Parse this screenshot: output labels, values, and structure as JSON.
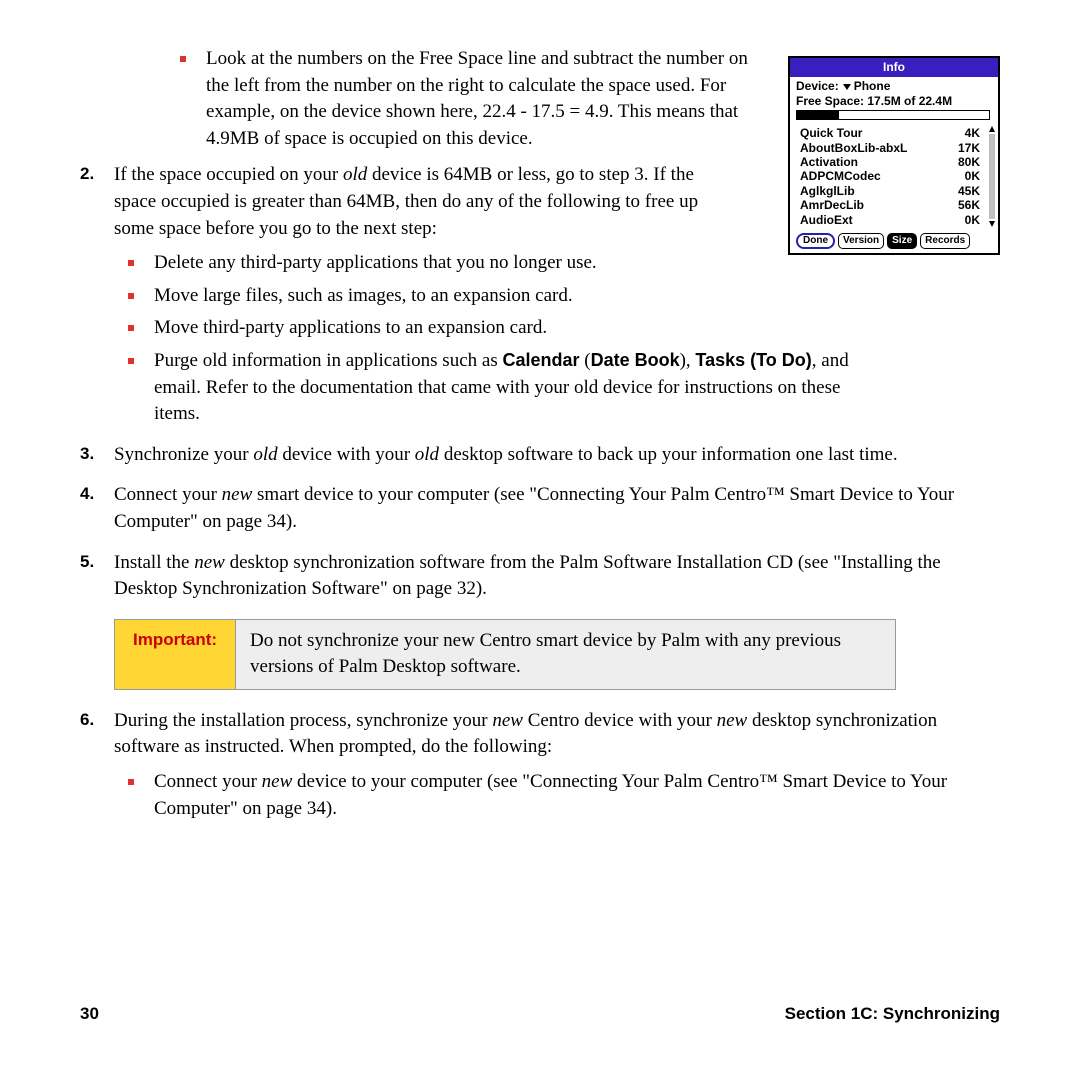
{
  "bullet1": "Look at the numbers on the Free Space line and subtract the number on the left from the number on the right to calculate the space used. For example, on the device shown here, 22.4 - 17.5 = 4.9. This means that 4.9MB of space is occupied on this device.",
  "steps": {
    "s2": {
      "num": "2.",
      "text_a": "If the space occupied on your ",
      "text_b": " device is 64MB or less, go to step 3. If the space occupied is greater than 64MB, then do any of the following to free up some space before you go to the next step:",
      "old": "old",
      "sub": {
        "a": "Delete any third-party applications that you no longer use.",
        "b": "Move large files, such as images, to an expansion card.",
        "c": "Move third-party applications to an expansion card.",
        "d_pre": "Purge old information in applications such as ",
        "d_cal": "Calendar",
        "d_paren1": " (",
        "d_db": "Date Book",
        "d_paren2": "), ",
        "d_tasks": "Tasks (To Do)",
        "d_post": ", and email. Refer to the documentation that came with your old device for instructions on these items."
      }
    },
    "s3": {
      "num": "3.",
      "a": "Synchronize your ",
      "old1": "old",
      "b": " device with your ",
      "old2": "old",
      "c": " desktop software to back up your information one last time."
    },
    "s4": {
      "num": "4.",
      "a": "Connect your ",
      "new1": "new",
      "b": " smart device to your computer (see \"Connecting Your Palm Centro™ Smart Device to Your Computer\" on page 34)."
    },
    "s5": {
      "num": "5.",
      "a": "Install the ",
      "new1": "new",
      "b": " desktop synchronization software from the Palm Software Installation CD (see \"Installing the Desktop Synchronization Software\" on page 32)."
    },
    "s6": {
      "num": "6.",
      "a": "During the installation process, synchronize your ",
      "new1": "new",
      "b": " Centro device with your ",
      "new2": "new",
      "c": " desktop synchronization software as instructed. When prompted, do the following:",
      "sub": {
        "a_pre": "Connect your ",
        "a_new": "new",
        "a_post": " device to your computer (see \"Connecting Your Palm Centro™ Smart Device to Your Computer\" on page 34)."
      }
    }
  },
  "important": {
    "label": "Important:",
    "text": "Do not synchronize your new Centro smart device by Palm with any previous versions of Palm Desktop software."
  },
  "footer": {
    "page": "30",
    "section": "Section 1C: Synchronizing"
  },
  "palm": {
    "title": "Info",
    "device_label": "Device:",
    "device_value": "Phone",
    "free_space": "Free Space: 17.5M of 22.4M",
    "items": [
      {
        "name": "Quick Tour",
        "size": "4K"
      },
      {
        "name": "AboutBoxLib-abxL",
        "size": "17K"
      },
      {
        "name": "Activation",
        "size": "80K"
      },
      {
        "name": "ADPCMCodec",
        "size": "0K"
      },
      {
        "name": "AglkglLib",
        "size": "45K"
      },
      {
        "name": "AmrDecLib",
        "size": "56K"
      },
      {
        "name": "AudioExt",
        "size": "0K"
      }
    ],
    "buttons": {
      "done": "Done",
      "version": "Version",
      "size": "Size",
      "records": "Records"
    }
  }
}
